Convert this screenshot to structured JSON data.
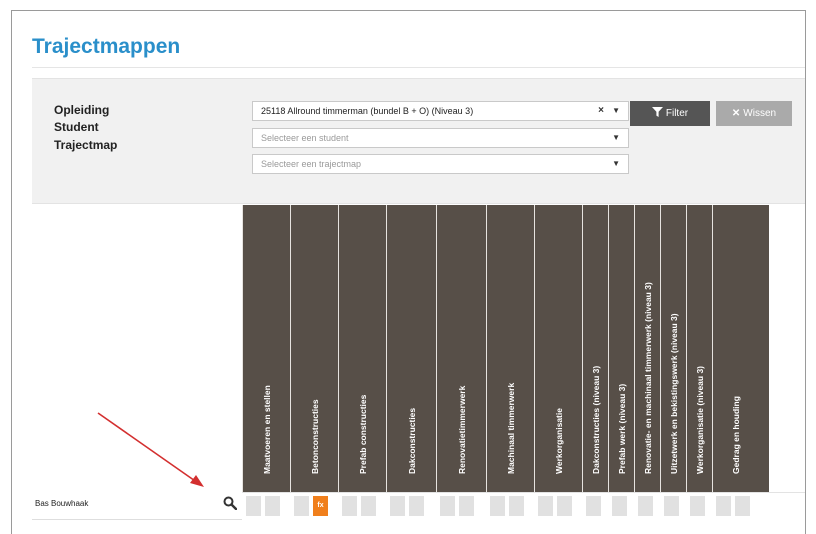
{
  "page": {
    "title": "Trajectmappen"
  },
  "filters": {
    "opleiding": {
      "label": "Opleiding",
      "value": "25118 Allround timmerman (bundel B + O) (Niveau 3)",
      "clear_glyph": "×"
    },
    "student": {
      "label": "Student",
      "placeholder": "Selecteer een student"
    },
    "trajectmap": {
      "label": "Trajectmap",
      "placeholder": "Selecteer een trajectmap"
    },
    "caret_glyph": "▼",
    "filter_button": {
      "icon": "filter-icon",
      "label": "Filter"
    },
    "clear_button": {
      "icon": "close-icon",
      "label": "Wissen",
      "glyph": "✕"
    }
  },
  "matrix": {
    "columns": [
      "Maatvoeren en stellen",
      "Betonconstructies",
      "Prefab constructies",
      "Dakconstructies",
      "Renovatietimmerwerk",
      "Machinaal timmerwerk",
      "Werkorganisatie",
      "Dakconstructies (niveau 3)",
      "Prefab werk (niveau 3)",
      "Renovatie- en machinaal timmerwerk (niveau 3)",
      "Uitzetwerk en bekistingswerk (niveau 3)",
      "Werkorganisatie (niveau 3)",
      "Gedrag en houding"
    ],
    "student_row": {
      "name": "Bas Bouwhaak",
      "search_icon": "search-icon",
      "active_cell_label": "fx"
    }
  },
  "colors": {
    "title": "#2a8fca",
    "matrix_header": "#574f48",
    "active_cell": "#f07f1c",
    "empty_cell": "#e1e1e1",
    "annotation_arrow": "#d32f2f"
  }
}
